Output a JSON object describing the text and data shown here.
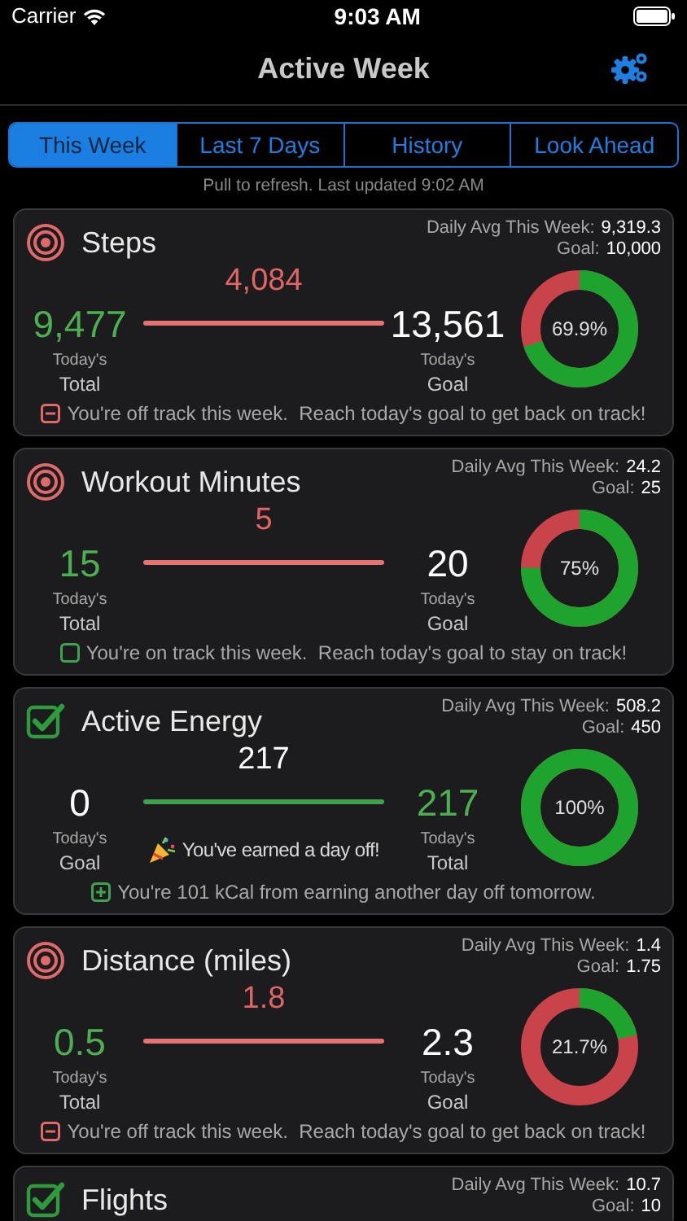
{
  "status_bar": {
    "carrier": "Carrier",
    "time": "9:03 AM"
  },
  "nav": {
    "title": "Active Week"
  },
  "tabs": [
    {
      "label": "This Week",
      "selected": true
    },
    {
      "label": "Last 7 Days",
      "selected": false
    },
    {
      "label": "History",
      "selected": false
    },
    {
      "label": "Look Ahead",
      "selected": false
    }
  ],
  "refresh_note": "Pull to refresh.  Last updated 9:02 AM",
  "cards": [
    {
      "met": false,
      "title": "Steps",
      "avg_label": "Daily Avg This Week:",
      "avg_value": "9,319.3",
      "goal_label": "Goal:",
      "goal_value": "10,000",
      "left": {
        "kind": "total",
        "value": "9,477",
        "line1": "Today's",
        "line2": "Total"
      },
      "remaining": "4,084",
      "right": {
        "kind": "goal",
        "value": "13,561",
        "line1": "Today's",
        "line2": "Goal"
      },
      "level": 0.699,
      "percent": "69.9%",
      "note": {
        "kind": "minus",
        "text": "You're off track this week.  Reach today's goal to get back on track!"
      }
    },
    {
      "met": false,
      "title": "Workout Minutes",
      "avg_label": "Daily Avg This Week:",
      "avg_value": "24.2",
      "goal_label": "Goal:",
      "goal_value": "25",
      "left": {
        "kind": "total",
        "value": "15",
        "line1": "Today's",
        "line2": "Total"
      },
      "remaining": "5",
      "right": {
        "kind": "goal",
        "value": "20",
        "line1": "Today's",
        "line2": "Goal"
      },
      "level": 0.75,
      "percent": "75%",
      "note": {
        "kind": "empty",
        "text": "You're on track this week.  Reach today's goal to stay on track!"
      }
    },
    {
      "met": true,
      "title": "Active Energy",
      "avg_label": "Daily Avg This Week:",
      "avg_value": "508.2",
      "goal_label": "Goal:",
      "goal_value": "450",
      "left": {
        "kind": "goal",
        "value": "0",
        "line1": "Today's",
        "line2": "Goal"
      },
      "remaining": "217",
      "right": {
        "kind": "total",
        "value": "217",
        "line1": "Today's",
        "line2": "Total"
      },
      "celebration": "You've earned a day off!",
      "level": 1,
      "percent": "100%",
      "note": {
        "kind": "plus",
        "text": "You're 101 kCal from earning another day off tomorrow."
      }
    },
    {
      "met": false,
      "title": "Distance (miles)",
      "avg_label": "Daily Avg This Week:",
      "avg_value": "1.4",
      "goal_label": "Goal:",
      "goal_value": "1.75",
      "left": {
        "kind": "total",
        "value": "0.5",
        "line1": "Today's",
        "line2": "Total"
      },
      "remaining": "1.8",
      "right": {
        "kind": "goal",
        "value": "2.3",
        "line1": "Today's",
        "line2": "Goal"
      },
      "level": 0.217,
      "percent": "21.7%",
      "note": {
        "kind": "minus",
        "text": "You're off track this week.  Reach today's goal to get back on track!"
      }
    },
    {
      "met": true,
      "title": "Flights",
      "avg_label": "Daily Avg This Week:",
      "avg_value": "10.7",
      "goal_label": "Goal:",
      "goal_value": "10"
    }
  ]
}
